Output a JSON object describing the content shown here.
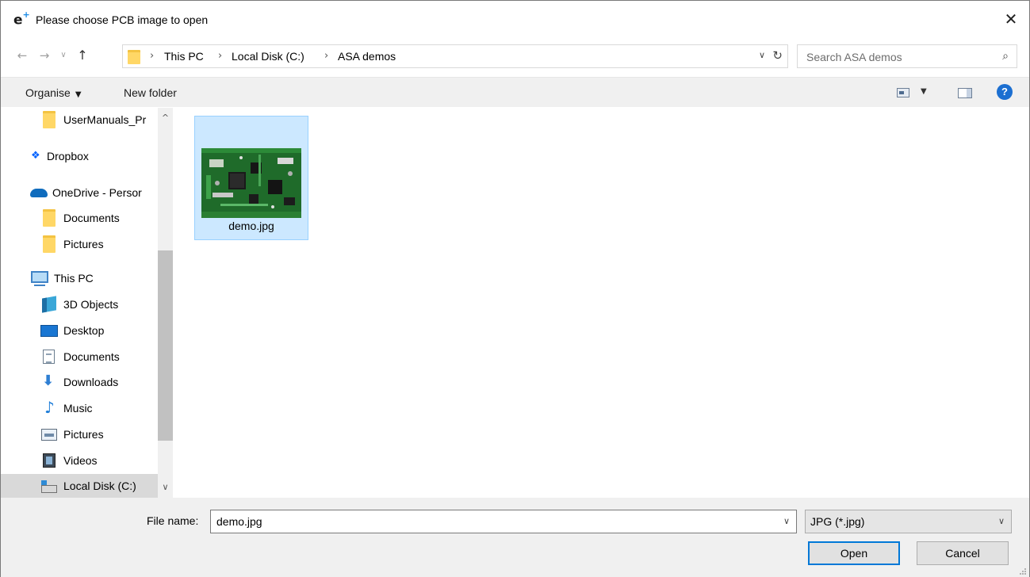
{
  "window": {
    "title": "Please choose PCB image to open",
    "app_icon_letter": "e",
    "app_icon_sup": "+",
    "close_glyph": "✕"
  },
  "nav": {
    "back_glyph": "←",
    "forward_glyph": "→",
    "recent_glyph": "∨",
    "up_glyph": "↑",
    "breadcrumbs": [
      "This PC",
      "Local Disk (C:)",
      "ASA demos"
    ],
    "separator": "›",
    "dropdown_glyph": "∨",
    "refresh_glyph": "↻",
    "search_placeholder": "Search ASA demos",
    "search_glyph": "⌕"
  },
  "toolbar": {
    "organise_label": "Organise",
    "organise_caret": "▼",
    "new_folder_label": "New folder",
    "view_caret": "▼",
    "help_label": "?"
  },
  "sidebar": {
    "items": [
      {
        "label": "UserManuals_Pr",
        "icon": "folder-icon"
      },
      {
        "label": "Dropbox",
        "icon": "dropbox-icon"
      },
      {
        "label": "OneDrive - Persor",
        "icon": "onedrive-icon"
      },
      {
        "label": "Documents",
        "icon": "folder-icon"
      },
      {
        "label": "Pictures",
        "icon": "folder-icon"
      },
      {
        "label": "This PC",
        "icon": "this-pc-icon"
      },
      {
        "label": "3D Objects",
        "icon": "3d-objects-icon"
      },
      {
        "label": "Desktop",
        "icon": "desktop-icon"
      },
      {
        "label": "Documents",
        "icon": "documents-icon"
      },
      {
        "label": "Downloads",
        "icon": "downloads-icon"
      },
      {
        "label": "Music",
        "icon": "music-icon"
      },
      {
        "label": "Pictures",
        "icon": "pictures-icon"
      },
      {
        "label": "Videos",
        "icon": "videos-icon"
      },
      {
        "label": "Local Disk (C:)",
        "icon": "local-disk-icon",
        "selected": true
      }
    ],
    "dropbox_glyph": "❖",
    "downloads_glyph": "⬇",
    "music_glyph": "♪",
    "scroll_up_glyph": "^",
    "scroll_down_glyph": "∨"
  },
  "files": [
    {
      "name": "demo.jpg",
      "selected": true
    }
  ],
  "footer": {
    "file_name_label": "File name:",
    "file_name_value": "demo.jpg",
    "file_name_drop": "∨",
    "file_type_value": "JPG (*.jpg)",
    "file_type_drop": "∨",
    "open_label": "Open",
    "cancel_label": "Cancel"
  },
  "colors": {
    "selection_bg": "#cce8ff",
    "selection_border": "#99d1ff",
    "default_button_border": "#0078d7",
    "help_blue": "#1c6fd1",
    "pcb_green": "#1f6b2a"
  }
}
